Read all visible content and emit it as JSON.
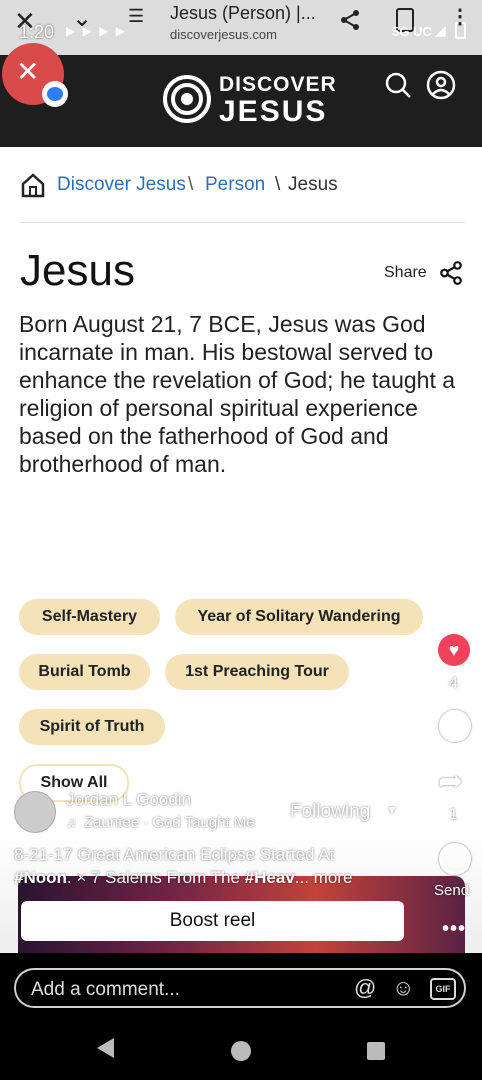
{
  "status_bar": {
    "time": "1:20",
    "network": "5G UC"
  },
  "browser": {
    "page_title": "Jesus (Person) |...",
    "url": "discoverjesus.com"
  },
  "site": {
    "logo_line1": "DISCOVER",
    "logo_line2": "JESUS"
  },
  "breadcrumb": {
    "item1": "Discover Jesus",
    "item2": "Person",
    "item3": "Jesus",
    "sep": "\\"
  },
  "article": {
    "title": "Jesus",
    "share_label": "Share",
    "body": "Born August 21, 7 BCE, Jesus was God incarnate in man. His bestowal served to enhance the revelation of God; he taught a religion of personal spiritual experience based on the fatherhood of God and brotherhood of man.",
    "tags": [
      "Self-Mastery",
      "Year of Solitary Wandering",
      "Burial Tomb",
      "1st Preaching Tour",
      "Spirit of Truth"
    ],
    "show_all": "Show All"
  },
  "reel": {
    "author": "Jordan L Goodin",
    "audio": "Zauntee · God Taught Me",
    "follow_label": "Following",
    "caption_line1": "8-21-17 Great American Eclipse Started At",
    "caption_hash1": "#Noon",
    "caption_mid": ". × 7 Salems From The ",
    "caption_hash2": "#Heav",
    "caption_more": "... more",
    "like_count": "4",
    "share_count": "1",
    "send_label": "Send",
    "boost_label": "Boost reel",
    "comment_placeholder": "Add a comment..."
  },
  "colors": {
    "accent_blue": "#2e6fb7",
    "tag_bg": "#f4e3b8",
    "header_bg": "#1e1e1e",
    "like_red": "#f0405a"
  }
}
